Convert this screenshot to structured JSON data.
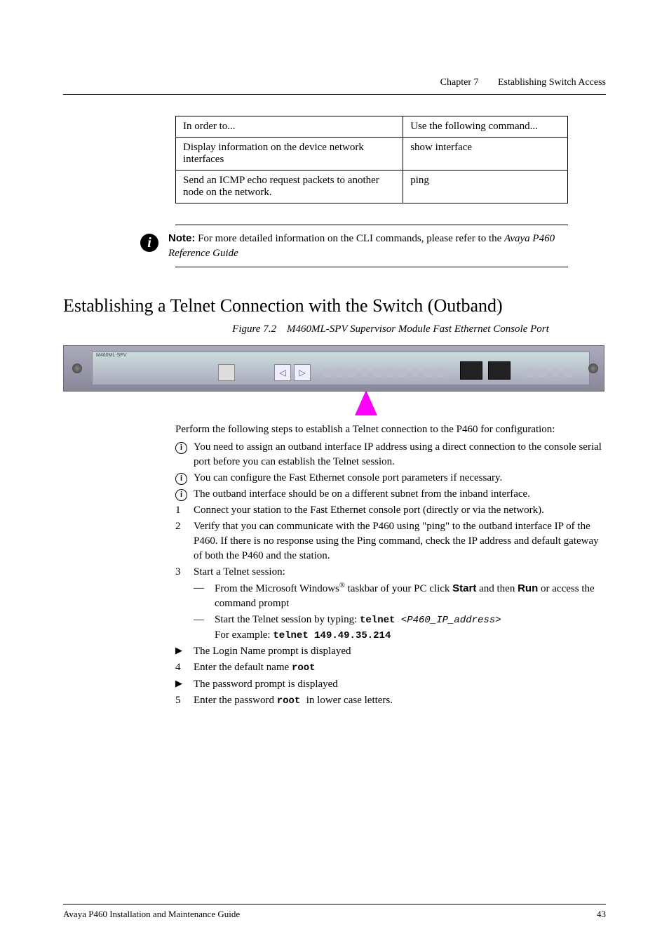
{
  "header": {
    "chapter": "Chapter 7",
    "title": "Establishing Switch Access"
  },
  "table": {
    "rows": [
      [
        "In order to...",
        "Use the following command..."
      ],
      [
        "Display information on the device network interfaces",
        "show interface"
      ],
      [
        "Send an ICMP echo request packets to another node on the network.",
        "ping"
      ]
    ]
  },
  "note": {
    "label": "Note:",
    "text_a": " For more detailed information on the CLI commands, please refer to the ",
    "text_b": "Avaya P460 Reference Guide"
  },
  "section_heading": "Establishing a Telnet Connection with the Switch (Outband)",
  "figure": {
    "caption_prefix": "Figure 7.2",
    "caption_title": "M460ML-SPV Supervisor Module Fast Ethernet Console Port",
    "device_label": "M460ML-SPV"
  },
  "intro": {
    "line1": "Perform the following steps to establish a Telnet connection to the P460 for configuration:"
  },
  "items": {
    "i1": "You need to assign an outband interface IP address using a direct connection to the console serial port before you can establish the Telnet session.",
    "i2": "You can configure the Fast Ethernet console port parameters if necessary.",
    "i3": "The outband interface should be on a different subnet from the inband interface.",
    "n1": "Connect your station to the Fast Ethernet console port (directly or via the network).",
    "n2": "Verify that you can communicate with the P460 using \"ping\" to the outband interface IP of the P460. If there is no response using the Ping command, check the IP address and default gateway of both the P460 and the station.",
    "n3": "Start a Telnet session:",
    "n3a_pre": "From the Microsoft Windows",
    "n3a_post": " taskbar of your PC click ",
    "n3a_start": "Start",
    "n3a_mid": " and then ",
    "n3a_run": "Run",
    "n3a_end": " or access the command prompt",
    "n3b_pre": "Start the Telnet session by typing: ",
    "n3b_cmd": "telnet",
    "n3b_arg": " <P460_IP_address>",
    "n3b_eg_label": "For example: ",
    "n3b_eg": "telnet 149.49.35.214",
    "t1": "The Login Name prompt is displayed",
    "n4_pre": "Enter the default name ",
    "n4_cmd": " root",
    "t2": "The password prompt is displayed",
    "n5_pre": "Enter the password ",
    "n5_cmd": " root ",
    "n5_post": " in lower case letters."
  },
  "markers": {
    "num1": "1",
    "num2": "2",
    "num3": "3",
    "num4": "4",
    "num5": "5",
    "dash": "—",
    "reg": "®"
  },
  "footer": {
    "left": "Avaya P460 Installation and Maintenance Guide",
    "right": "43"
  }
}
